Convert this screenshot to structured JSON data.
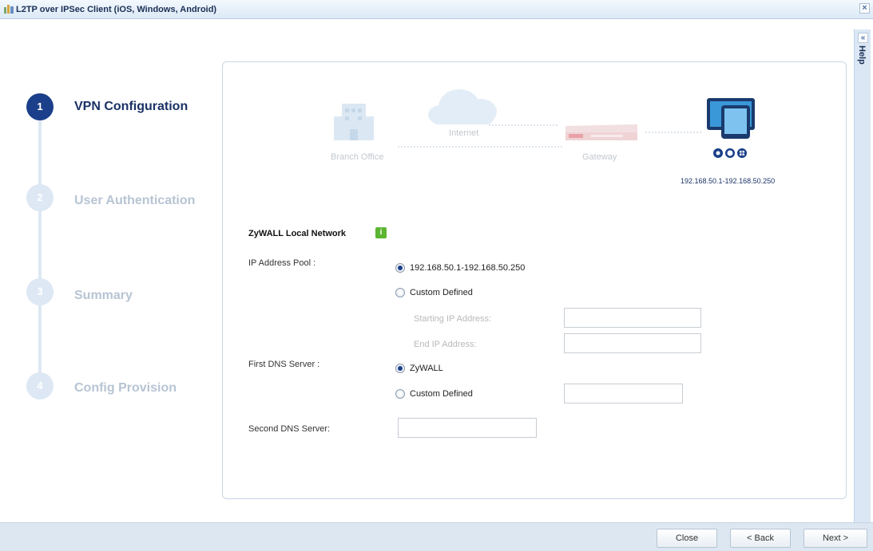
{
  "window": {
    "title": "L2TP over IPSec Client (iOS, Windows, Android)"
  },
  "help": {
    "label": "Help"
  },
  "steps": [
    {
      "number": "1",
      "label": "VPN Configuration",
      "active": true
    },
    {
      "number": "2",
      "label": "User Authentication",
      "active": false
    },
    {
      "number": "3",
      "label": "Summary",
      "active": false
    },
    {
      "number": "4",
      "label": "Config Provision",
      "active": false
    }
  ],
  "topology": {
    "branch_office": "Branch Office",
    "internet": "Internet",
    "gateway": "Gateway",
    "client_range": "192.168.50.1-192.168.50.250"
  },
  "form": {
    "section_title": "ZyWALL Local Network",
    "ip_pool_label": "IP Address Pool :",
    "ip_pool_options": [
      "192.168.50.1-192.168.50.250",
      "Custom Defined"
    ],
    "ip_pool_selected": "192.168.50.1-192.168.50.250",
    "starting_ip_label": "Starting IP Address:",
    "end_ip_label": "End IP Address:",
    "starting_ip_value": "",
    "end_ip_value": "",
    "first_dns_label": "First DNS Server :",
    "first_dns_options": [
      "ZyWALL",
      "Custom Defined"
    ],
    "first_dns_selected": "ZyWALL",
    "first_dns_custom_value": "",
    "second_dns_label": "Second DNS Server:",
    "second_dns_value": ""
  },
  "buttons": {
    "close": "Close",
    "back": "< Back",
    "next": "Next >"
  },
  "colors": {
    "accent": "#1b3f8a",
    "info": "#5cb531",
    "inactive": "#b7c4d3"
  }
}
